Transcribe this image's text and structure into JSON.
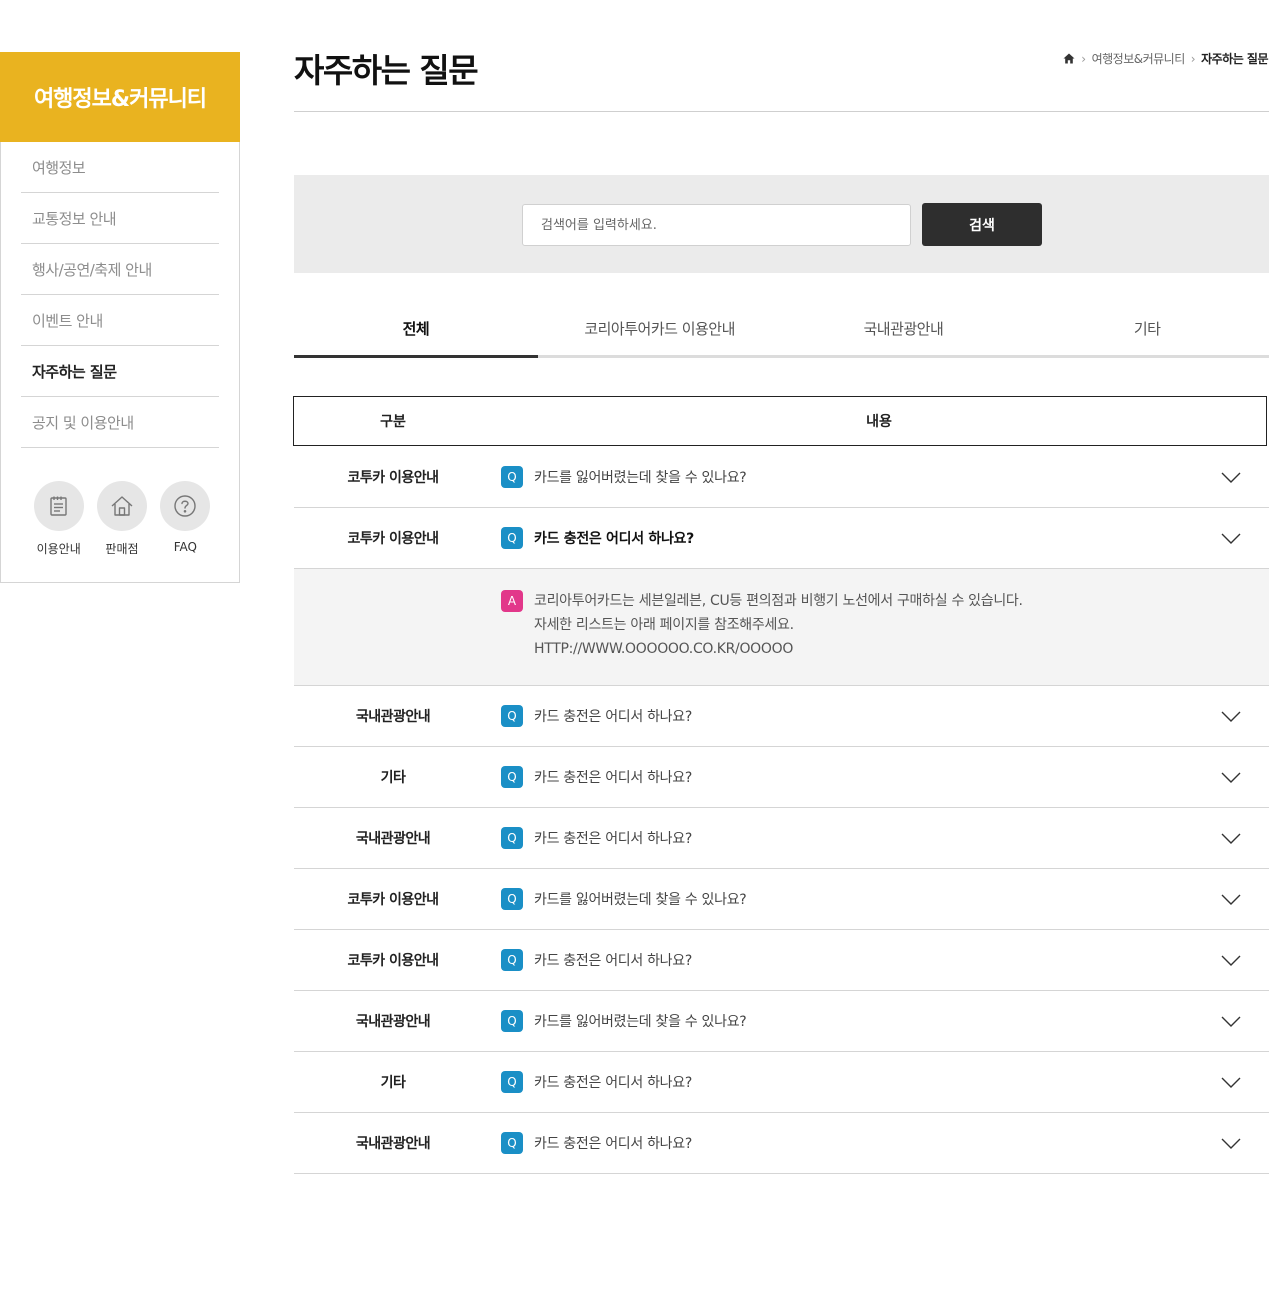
{
  "sidebar": {
    "title": "여행정보&커뮤니티",
    "items": [
      {
        "label": "여행정보"
      },
      {
        "label": "교통정보 안내"
      },
      {
        "label": "행사/공연/축제 안내"
      },
      {
        "label": "이벤트 안내"
      },
      {
        "label": "자주하는 질문",
        "active": true
      },
      {
        "label": "공지 및 이용안내"
      }
    ],
    "quick_links": [
      {
        "label": "이용안내",
        "icon": "notepad-icon"
      },
      {
        "label": "판매점",
        "icon": "home-icon"
      },
      {
        "label": "FAQ",
        "icon": "question-icon"
      }
    ]
  },
  "page": {
    "title": "자주하는 질문"
  },
  "breadcrumb": {
    "home_icon": "home-icon",
    "items": [
      "여행정보&커뮤니티",
      "자주하는 질문"
    ]
  },
  "search": {
    "placeholder": "검색어를 입력하세요.",
    "button_label": "검색"
  },
  "tabs": [
    {
      "label": "전체",
      "active": true
    },
    {
      "label": "코리아투어카드 이용안내"
    },
    {
      "label": "국내관광안내"
    },
    {
      "label": "기타"
    }
  ],
  "table": {
    "headers": {
      "category": "구분",
      "content": "내용"
    },
    "q_badge": "Q",
    "a_badge": "A",
    "rows": [
      {
        "category": "코투카 이용안내",
        "question": "카드를 잃어버렸는데 찾을 수 있나요?"
      },
      {
        "category": "코투카 이용안내",
        "question": "카드 충전은 어디서 하나요?",
        "open": true,
        "answer": [
          "코리아투어카드는 세븐일레븐, CU등 편의점과 비행기 노선에서 구매하실 수 있습니다.",
          "자세한 리스트는 아래 페이지를 참조해주세요.",
          "HTTP://WWW.OOOOOO.CO.KR/OOOOO"
        ]
      },
      {
        "category": "국내관광안내",
        "question": "카드 충전은 어디서 하나요?"
      },
      {
        "category": "기타",
        "question": "카드 충전은 어디서 하나요?"
      },
      {
        "category": "국내관광안내",
        "question": "카드 충전은 어디서 하나요?"
      },
      {
        "category": "코투카 이용안내",
        "question": "카드를 잃어버렸는데 찾을 수 있나요?"
      },
      {
        "category": "코투카 이용안내",
        "question": "카드 충전은 어디서 하나요?"
      },
      {
        "category": "국내관광안내",
        "question": "카드를 잃어버렸는데 찾을 수 있나요?"
      },
      {
        "category": "기타",
        "question": "카드 충전은 어디서 하나요?"
      },
      {
        "category": "국내관광안내",
        "question": "카드 충전은 어디서 하나요?"
      }
    ]
  },
  "colors": {
    "accent": "#e9b320",
    "q_badge": "#1a8fc6",
    "a_badge": "#e2378a",
    "search_button": "#2e2e2e"
  }
}
